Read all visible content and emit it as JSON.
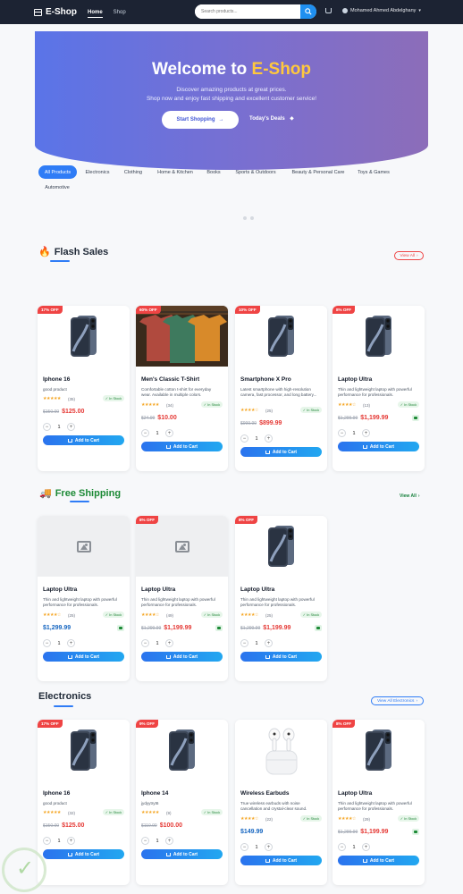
{
  "nav": {
    "brand": "E-Shop",
    "links": [
      "Home",
      "Shop"
    ],
    "search_placeholder": "Search products...",
    "user": "Mohamed Ahmed Abdelghany"
  },
  "hero": {
    "title_pre": "Welcome to ",
    "title_accent": "E-Shop",
    "sub1": "Discover amazing products at great prices.",
    "sub2": "Shop now and enjoy fast shipping and excellent customer service!",
    "btn_shop": "Start Shopping",
    "btn_deals": "Today's Deals"
  },
  "categories": [
    "All Products",
    "Electronics",
    "Clothing",
    "Home & Kitchen",
    "Books",
    "Sports & Outdoors",
    "Beauty & Personal Care",
    "Toys & Games",
    "Automotive"
  ],
  "sections": {
    "flash": {
      "title": "Flash Sales",
      "action": "View All"
    },
    "free": {
      "title": "Free Shipping",
      "action": "View All"
    },
    "elec": {
      "title": "Electronics",
      "action": "View All Electronics"
    }
  },
  "common": {
    "add": "Add to Cart",
    "stock": "In Stock",
    "qty": "1",
    "minus": "−",
    "plus": "+"
  },
  "flash_cards": [
    {
      "badge": "17% OFF",
      "name": "Iphone 16",
      "desc": "good product",
      "count": "(35)",
      "old": "$150.00",
      "price": "$125.00",
      "stars": "★★★★★"
    },
    {
      "badge": "60% OFF",
      "name": "Men's Classic T-Shirt",
      "desc": "Comfortable cotton t-shirt for everyday wear. Available in multiple colors.",
      "count": "(34)",
      "old": "$24.99",
      "price": "$10.00",
      "stars": "★★★★★"
    },
    {
      "badge": "10% OFF",
      "name": "Smartphone X Pro",
      "desc": "Latest smartphone with high-resolution camera, fast processor, and long battery...",
      "count": "(25)",
      "old": "$999.99",
      "price": "$899.99",
      "stars": "★★★★☆"
    },
    {
      "badge": "8% OFF",
      "name": "Laptop Ultra",
      "desc": "Thin and lightweight laptop with powerful performance for professionals.",
      "count": "(13)",
      "old": "$1,299.99",
      "price": "$1,199.99",
      "stars": "★★★★☆"
    }
  ],
  "free_cards": [
    {
      "badge": "",
      "name": "Laptop Ultra",
      "desc": "Thin and lightweight laptop with powerful performance for professionals.",
      "count": "(25)",
      "old": "",
      "price": "$1,299.99",
      "stars": "★★★★☆"
    },
    {
      "badge": "8% OFF",
      "name": "Laptop Ultra",
      "desc": "Thin and lightweight laptop with powerful performance for professionals.",
      "count": "(49)",
      "old": "$1,299.99",
      "price": "$1,199.99",
      "stars": "★★★★☆"
    },
    {
      "badge": "8% OFF",
      "name": "Laptop Ultra",
      "desc": "Thin and lightweight laptop with powerful performance for professionals.",
      "count": "(25)",
      "old": "$1,299.99",
      "price": "$1,199.99",
      "stars": "★★★★☆"
    }
  ],
  "elec_cards": [
    {
      "badge": "17% OFF",
      "name": "Iphone 16",
      "desc": "good product",
      "count": "(32)",
      "old": "$150.00",
      "price": "$125.00",
      "stars": "★★★★★"
    },
    {
      "badge": "9% OFF",
      "name": "Iphone 14",
      "desc": "jydyytryt6",
      "count": "(9)",
      "old": "$110.00",
      "price": "$100.00",
      "stars": "★★★★★"
    },
    {
      "badge": "",
      "name": "Wireless Earbuds",
      "desc": "True wireless earbuds with noise cancellation and crystal-clear sound.",
      "count": "(22)",
      "old": "",
      "price": "$149.99",
      "stars": "★★★★☆"
    },
    {
      "badge": "8% OFF",
      "name": "Laptop Ultra",
      "desc": "Thin and lightweight laptop with powerful performance for professionals.",
      "count": "(29)",
      "old": "$1,299.99",
      "price": "$1,199.99",
      "stars": "★★★★☆"
    }
  ]
}
